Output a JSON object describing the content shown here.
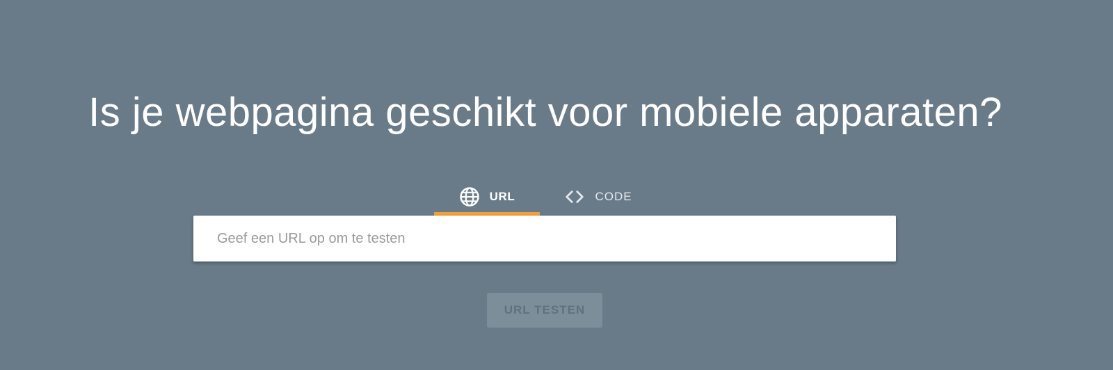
{
  "headline": "Is je webpagina geschikt voor mobiele apparaten?",
  "tabs": [
    {
      "label": "URL",
      "icon": "globe-icon",
      "active": true
    },
    {
      "label": "CODE",
      "icon": "code-icon",
      "active": false
    }
  ],
  "url_input": {
    "value": "",
    "placeholder": "Geef een URL op om te testen"
  },
  "test_button": {
    "label": "URL TESTEN",
    "disabled": true
  },
  "colors": {
    "background": "#697b89",
    "accent": "#f0a13c",
    "text": "#ffffff"
  }
}
